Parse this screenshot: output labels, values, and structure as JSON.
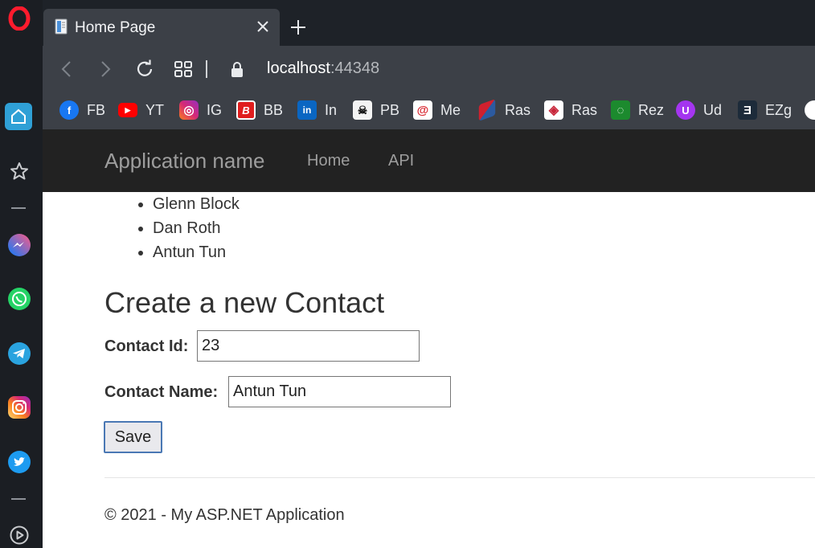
{
  "browser": {
    "tab": {
      "title": "Home Page"
    },
    "address": {
      "host": "localhost",
      "port": ":44348"
    },
    "bookmarks": [
      {
        "label": "FB",
        "icon": "facebook-icon",
        "color": "#1877f2"
      },
      {
        "label": "YT",
        "icon": "youtube-icon",
        "color": "#ff0000"
      },
      {
        "label": "IG",
        "icon": "instagram-icon",
        "color": "#d62976"
      },
      {
        "label": "BB",
        "icon": "bb-icon",
        "color": "#e01e1e"
      },
      {
        "label": "In",
        "icon": "linkedin-icon",
        "color": "#0a66c2"
      },
      {
        "label": "PB",
        "icon": "pb-icon",
        "color": "#2b2b2b"
      },
      {
        "label": "Me",
        "icon": "me-icon",
        "color": "#d8252e"
      },
      {
        "label": "Ras",
        "icon": "ras-icon",
        "color": "#d0202e"
      },
      {
        "label": "Ras",
        "icon": "ras-dots-icon",
        "color": "#c8263a"
      },
      {
        "label": "Rez",
        "icon": "rez-icon",
        "color": "#1c8a2e"
      },
      {
        "label": "Ud",
        "icon": "udemy-icon",
        "color": "#a435f0"
      },
      {
        "label": "EZg",
        "icon": "ezg-icon",
        "color": "#1d2b3a"
      }
    ]
  },
  "page": {
    "brand": "Application name",
    "nav": [
      "Home",
      "API"
    ],
    "contacts": [
      "Glenn Block",
      "Dan Roth",
      "Antun Tun"
    ],
    "form": {
      "title": "Create a new Contact",
      "id_label": "Contact Id:",
      "id_value": "23",
      "name_label": "Contact Name:",
      "name_value": "Antun Tun",
      "save_label": "Save"
    },
    "footer": "© 2021 - My ASP.NET Application"
  },
  "colors": {
    "sidebar": "#1b1e23",
    "chrome": "#3c4047",
    "navbar": "#222222",
    "accent": "#4a78b4"
  }
}
